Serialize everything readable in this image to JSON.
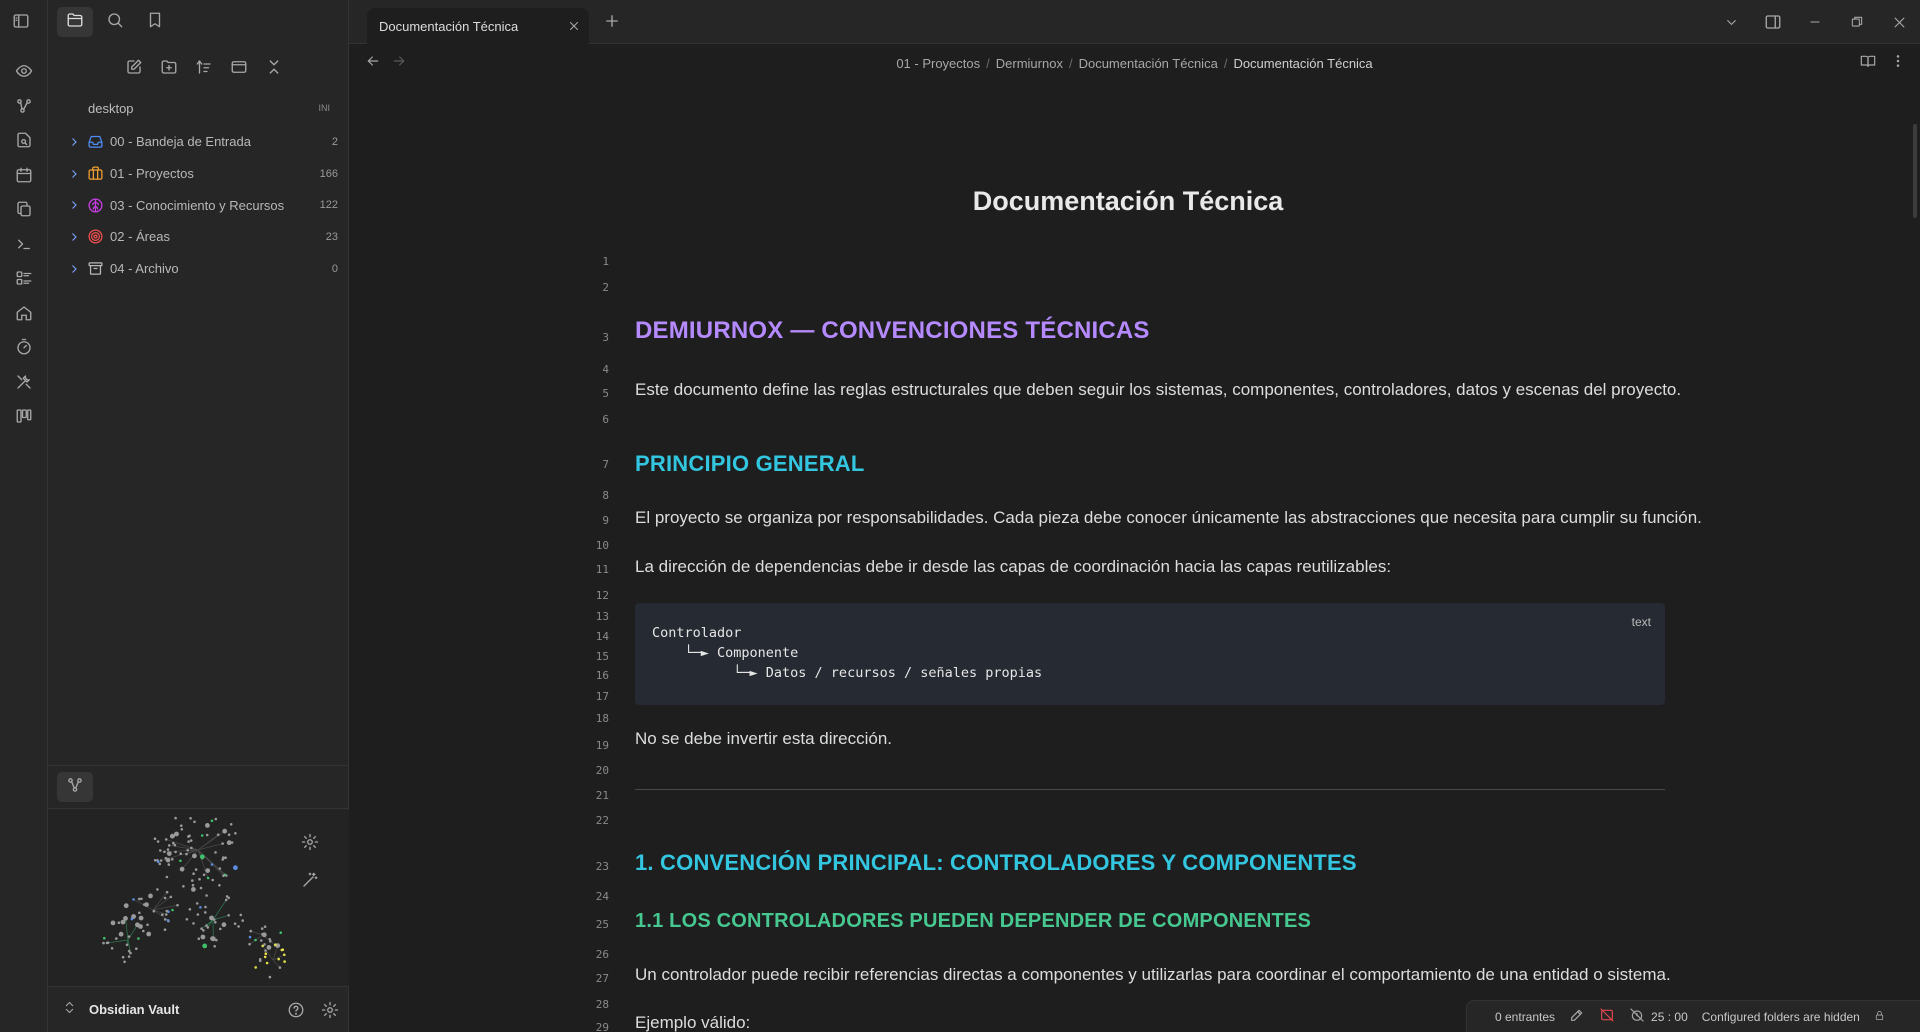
{
  "colors": {
    "background": "#1e1e1e",
    "sidebar": "#262626",
    "h1": "#b68aff",
    "h2": "#33c6e0",
    "h3": "#46c890",
    "accent_chevron": "#7da3ff",
    "folder_inbox": "#4f8ef7",
    "folder_projects": "#f0a030",
    "folder_knowledge": "#c93ee6",
    "folder_areas": "#ef4f4f",
    "folder_archive": "#b8b8b8",
    "status_sync_off": "#e0474c"
  },
  "ribbon": {
    "toggle_icon": "sidebar-toggle-icon",
    "items": [
      {
        "icon": "eye-icon"
      },
      {
        "icon": "graph-icon"
      },
      {
        "icon": "file-search-icon"
      },
      {
        "icon": "calendar-icon"
      },
      {
        "icon": "copy-files-icon"
      },
      {
        "icon": "terminal-icon"
      },
      {
        "icon": "checklist-icon"
      },
      {
        "icon": "home-icon"
      },
      {
        "icon": "timer-icon"
      },
      {
        "icon": "tools-icon"
      },
      {
        "icon": "kanban-icon"
      }
    ]
  },
  "sidebar": {
    "tabs": [
      {
        "icon": "folder-icon",
        "active": true
      },
      {
        "icon": "search-icon",
        "active": false
      },
      {
        "icon": "bookmark-icon",
        "active": false
      }
    ],
    "toolbar": [
      "new-note-icon",
      "new-folder-icon",
      "sort-icon",
      "collapse-view-icon",
      "collapse-all-icon"
    ],
    "vault_root": {
      "label": "desktop",
      "badge": "INI"
    },
    "folders": [
      {
        "label": "00 - Bandeja de Entrada",
        "count": "2",
        "icon": "inbox-icon"
      },
      {
        "label": "01 - Proyectos",
        "count": "166",
        "icon": "briefcase-icon"
      },
      {
        "label": "03 - Conocimiento y Recursos",
        "count": "122",
        "icon": "brain-icon"
      },
      {
        "label": "02 - Áreas",
        "count": "23",
        "icon": "target-icon"
      },
      {
        "label": "04 - Archivo",
        "count": "0",
        "icon": "archive-icon"
      }
    ],
    "graph": {
      "tab_icon": "graph-icon",
      "controls": [
        "settings-icon",
        "magic-wand-icon"
      ]
    },
    "vault": {
      "name": "Obsidian Vault",
      "switch_icon": "chevrons-up-down-icon",
      "help_icon": "help-icon",
      "settings_icon": "settings-icon"
    }
  },
  "tabs": [
    {
      "title": "Documentación Técnica",
      "active": true
    }
  ],
  "breadcrumb": [
    "01 - Proyectos",
    "Dermiurnox",
    "Documentación Técnica",
    "Documentación Técnica"
  ],
  "document": {
    "title": "Documentación Técnica",
    "line_numbers": [
      "1",
      "2",
      "3",
      "4",
      "5",
      "6",
      "7",
      "8",
      "9",
      "10",
      "11",
      "12",
      "13",
      "14",
      "15",
      "16",
      "17",
      "18",
      "19",
      "20",
      "21",
      "22",
      "23",
      "24",
      "25",
      "26",
      "27",
      "28",
      "29"
    ],
    "h1": "DEMIURNOX — CONVENCIONES TÉCNICAS",
    "intro": "Este documento define las reglas estructurales que deben seguir los sistemas, componentes, controladores, datos y escenas del proyecto.",
    "h2_principio": "PRINCIPIO GENERAL",
    "p_organiza": "El proyecto se organiza por responsabilidades. Cada pieza debe conocer únicamente las abstracciones que necesita para cumplir su función.",
    "p_direccion": "La dirección de dependencias debe ir desde las capas de coordinación hacia las capas reutilizables:",
    "code": {
      "lang": "text",
      "lines": [
        "Controlador",
        "    └─► Componente",
        "          └─► Datos / recursos / señales propias"
      ]
    },
    "p_invertir": "No se debe invertir esta dirección.",
    "h2_convencion": "1. CONVENCIÓN PRINCIPAL: CONTROLADORES Y COMPONENTES",
    "h3_depender": "1.1 LOS CONTROLADORES PUEDEN DEPENDER DE COMPONENTES",
    "p_controlador": "Un controlador puede recibir referencias directas a componentes y utilizarlas para coordinar el comportamiento de una entidad o sistema.",
    "p_ejemplo": "Ejemplo válido:"
  },
  "statusbar": {
    "backlinks": "0 entrantes",
    "timer": "25 : 00",
    "hidden": "Configured folders are hidden"
  }
}
